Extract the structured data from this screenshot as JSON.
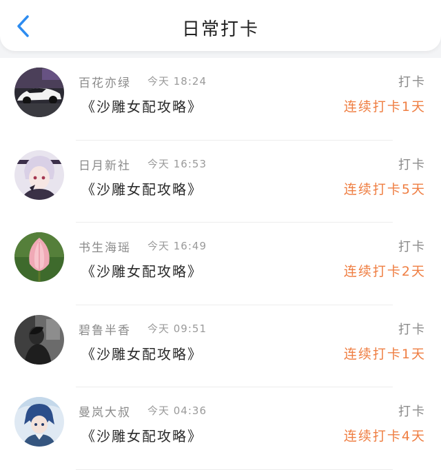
{
  "header": {
    "title": "日常打卡",
    "back_icon": "chevron-left-icon",
    "accent_color": "#2d8cf0"
  },
  "records": [
    {
      "user": "百花亦绿",
      "time": "今天 18:24",
      "book": "《沙雕女配攻略》",
      "action": "打卡",
      "streak": "连续打卡1天",
      "avatar": "sports-car-avatar"
    },
    {
      "user": "日月新社",
      "time": "今天 16:53",
      "book": "《沙雕女配攻略》",
      "action": "打卡",
      "streak": "连续打卡5天",
      "avatar": "anime-boy-avatar"
    },
    {
      "user": "书生海瑶",
      "time": "今天 16:49",
      "book": "《沙雕女配攻略》",
      "action": "打卡",
      "streak": "连续打卡2天",
      "avatar": "lotus-avatar"
    },
    {
      "user": "碧鲁半香",
      "time": "今天 09:51",
      "book": "《沙雕女配攻略》",
      "action": "打卡",
      "streak": "连续打卡1天",
      "avatar": "dark-portrait-avatar"
    },
    {
      "user": "曼岚大叔",
      "time": "今天 04:36",
      "book": "《沙雕女配攻略》",
      "action": "打卡",
      "streak": "连续打卡4天",
      "avatar": "anime-blue-hair-avatar"
    }
  ],
  "colors": {
    "streak": "#ef7e42",
    "muted": "#8a8a8a",
    "text": "#2a2a2a"
  }
}
